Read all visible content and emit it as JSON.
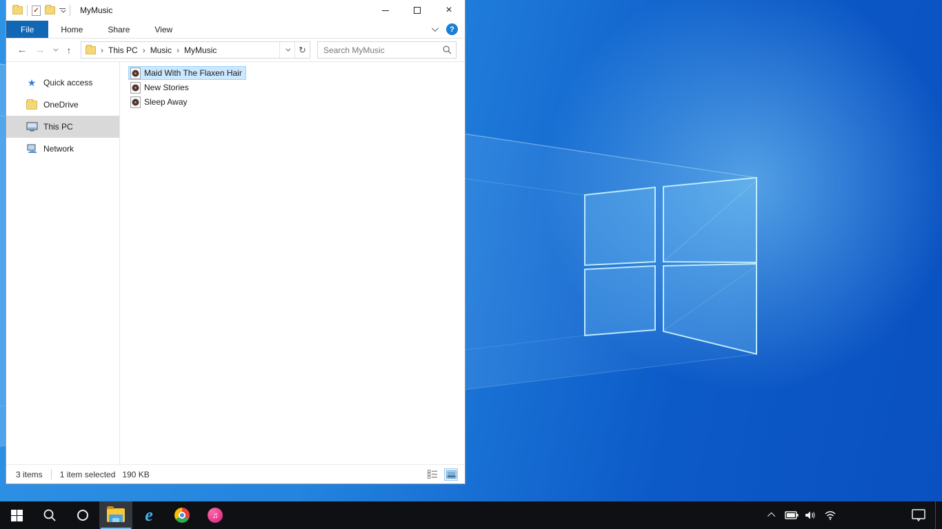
{
  "window": {
    "title": "MyMusic",
    "tabs": [
      {
        "label": "File"
      },
      {
        "label": "Home"
      },
      {
        "label": "Share"
      },
      {
        "label": "View"
      }
    ],
    "address": {
      "crumbs": [
        {
          "label": "This PC"
        },
        {
          "label": "Music"
        },
        {
          "label": "MyMusic"
        }
      ]
    },
    "search": {
      "placeholder": "Search MyMusic"
    },
    "sidebar": {
      "items": [
        {
          "label": "Quick access"
        },
        {
          "label": "OneDrive"
        },
        {
          "label": "This PC"
        },
        {
          "label": "Network"
        }
      ]
    },
    "files": [
      {
        "name": "Maid With The Flaxen Hair",
        "selected": true
      },
      {
        "name": "New Stories",
        "selected": false
      },
      {
        "name": "Sleep Away",
        "selected": false
      }
    ],
    "status": {
      "items_count": "3 items",
      "selection": "1 item selected",
      "selection_size": "190 KB"
    }
  },
  "taskbar": {
    "buttons": [
      {
        "name": "start"
      },
      {
        "name": "search"
      },
      {
        "name": "cortana"
      },
      {
        "name": "file-explorer",
        "active": true
      },
      {
        "name": "internet-explorer"
      },
      {
        "name": "chrome"
      },
      {
        "name": "itunes"
      }
    ]
  },
  "icons": {
    "back": "←",
    "forward": "→",
    "up": "↑",
    "refresh": "↻",
    "crumb_separator": "›",
    "quick_access_star": "★",
    "music_note": "♫",
    "check": "✓",
    "close": "×",
    "help": "?",
    "ie_letter": "e"
  },
  "colors": {
    "file_tab_bg": "#1267b5",
    "selection_bg": "#cce8ff",
    "selection_border": "#99d1ff",
    "sidebar_selected_bg": "#d9d9d9",
    "taskbar_bg": "#0f1013",
    "wallpaper_left": "#2f93e6",
    "wallpaper_right": "#0a50c0"
  }
}
